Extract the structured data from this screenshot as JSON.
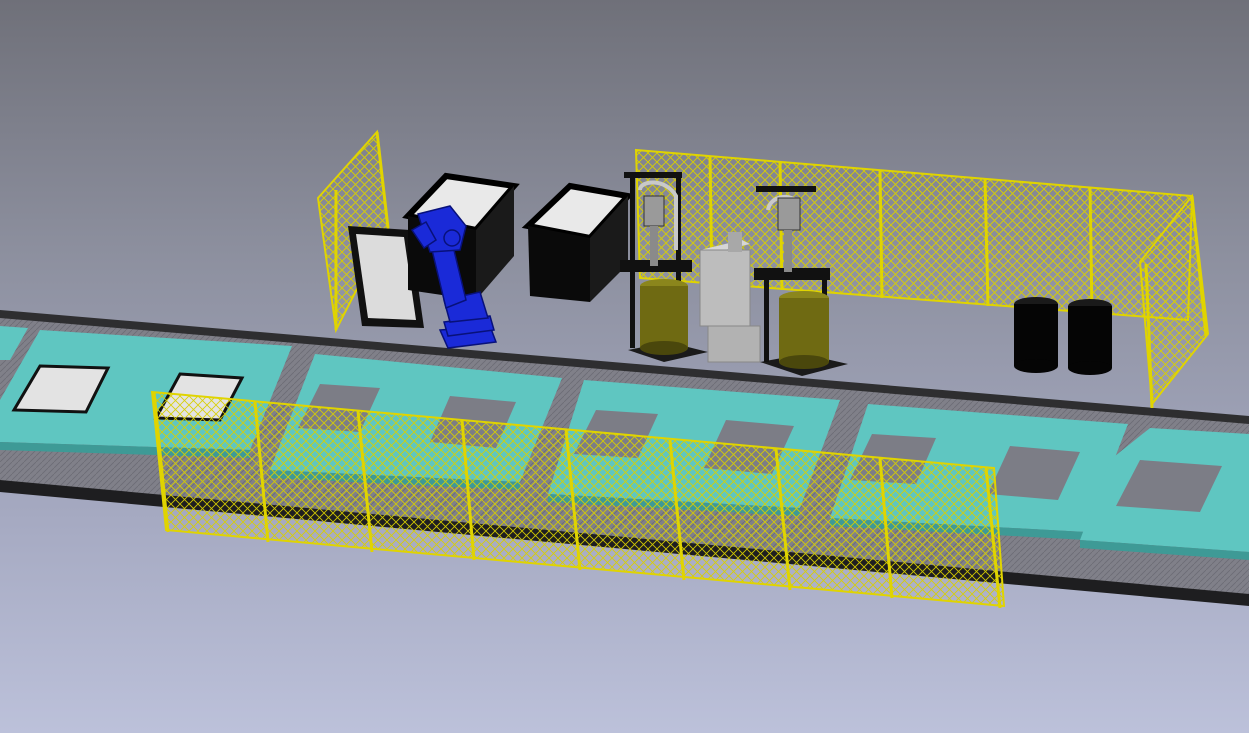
{
  "scene": {
    "colors": {
      "background_top": "#6f7079",
      "background_bottom": "#bcc1da",
      "conveyor_belt": "#7e7f86",
      "conveyor_edge": "#2e2e30",
      "mold_frame": "#5fc6c1",
      "fence": "#e0d400",
      "robot": "#1a2ad8",
      "cabinet": "#0a0a0a",
      "cabinet_top": "#e9e9e9",
      "drum_yellow": "#6f6a12",
      "drum_black": "#050505",
      "mixer_unit": "#bdbdbd"
    },
    "objects": {
      "conveyor_line": "conveyor",
      "mold_frames": 5,
      "robot_arm": "industrial-robot",
      "cabinets": 2,
      "open_panel": "door-panel",
      "dispensing_stations": 2,
      "mixer_unit": "mixing-unit",
      "yellow_drums": 2,
      "black_drums": 2,
      "fences": 4
    }
  }
}
